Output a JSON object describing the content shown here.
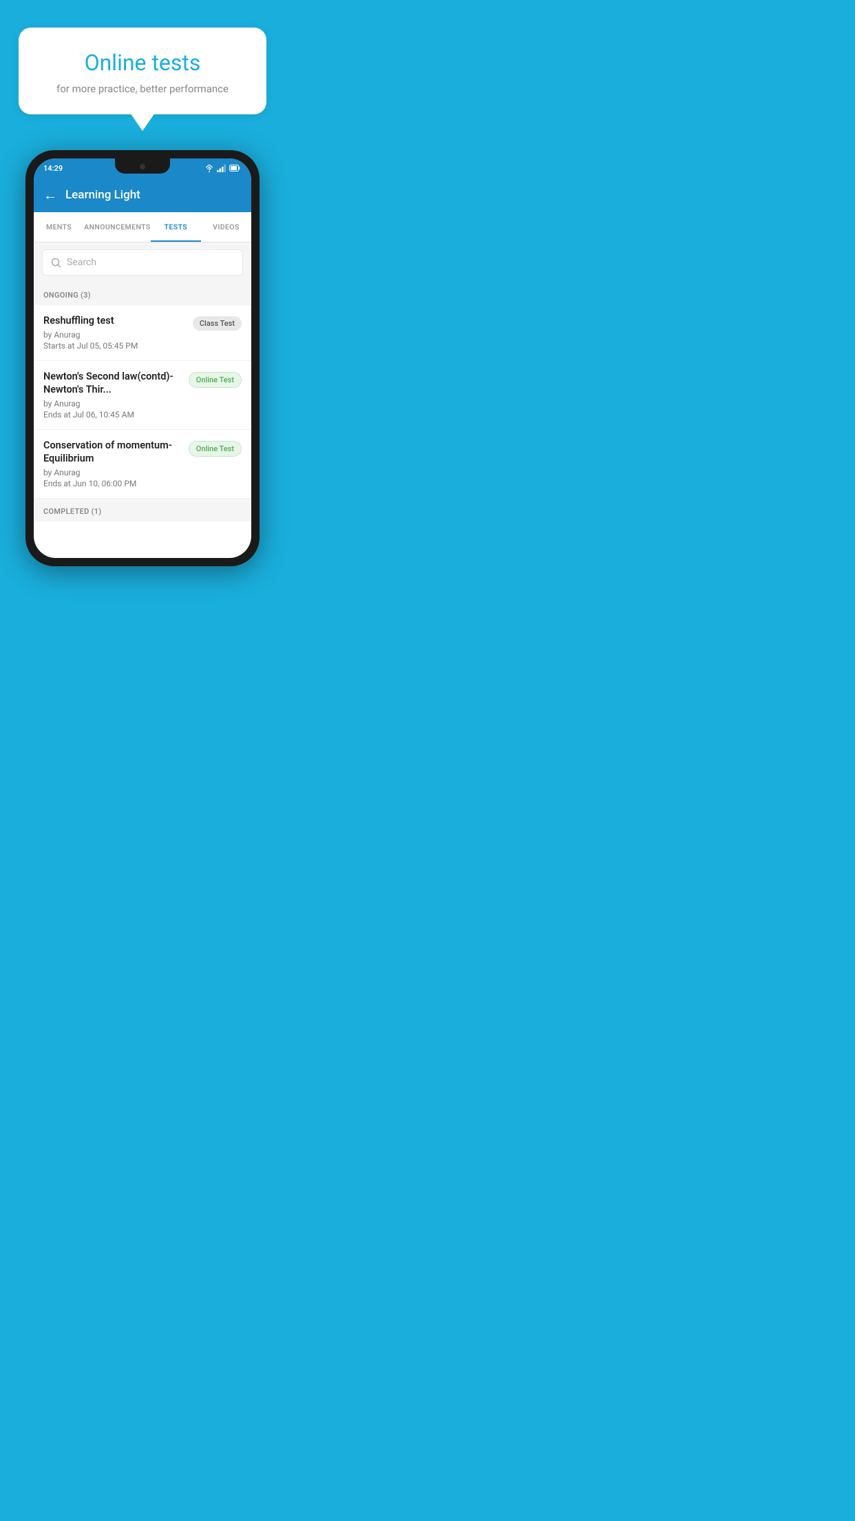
{
  "background_color": "#1AAEDC",
  "bubble": {
    "title": "Online tests",
    "subtitle": "for more practice, better performance"
  },
  "status_bar": {
    "time": "14:29",
    "wifi": true,
    "signal": true,
    "battery": true
  },
  "app_bar": {
    "title": "Learning Light",
    "back_label": "←"
  },
  "tabs": [
    {
      "label": "MENTS",
      "active": false
    },
    {
      "label": "ANNOUNCEMENTS",
      "active": false
    },
    {
      "label": "TESTS",
      "active": true
    },
    {
      "label": "VIDEOS",
      "active": false
    }
  ],
  "search": {
    "placeholder": "Search"
  },
  "sections": [
    {
      "header": "ONGOING (3)",
      "tests": [
        {
          "name": "Reshuffling test",
          "author": "by Anurag",
          "time": "Starts at  Jul 05, 05:45 PM",
          "badge": "Class Test",
          "badge_type": "class"
        },
        {
          "name": "Newton's Second law(contd)-Newton's Thir...",
          "author": "by Anurag",
          "time": "Ends at  Jul 06, 10:45 AM",
          "badge": "Online Test",
          "badge_type": "online"
        },
        {
          "name": "Conservation of momentum-Equilibrium",
          "author": "by Anurag",
          "time": "Ends at  Jun 10, 06:00 PM",
          "badge": "Online Test",
          "badge_type": "online"
        }
      ]
    }
  ],
  "completed_section": {
    "header": "COMPLETED (1)"
  }
}
